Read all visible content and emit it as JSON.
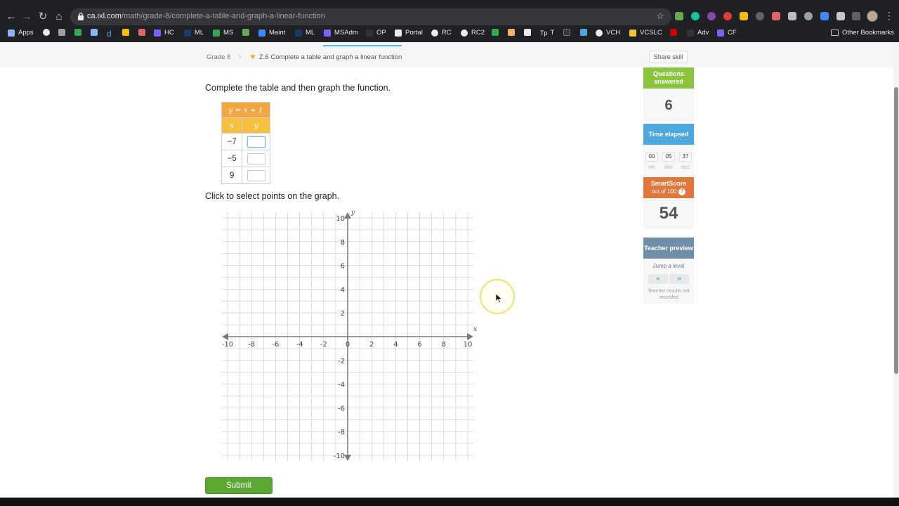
{
  "browser": {
    "url_host": "ca.ixl.com",
    "url_path": "/math/grade-8/complete-a-table-and-graph-a-linear-function",
    "bookmarks": [
      {
        "label": "Apps",
        "icon": "apps-grid-icon",
        "color": "#8ab4f8"
      },
      {
        "label": "",
        "icon": "star-bookmark-icon",
        "color": "#e8eaed"
      },
      {
        "label": "",
        "icon": "folder-icon",
        "color": "#9aa0a6"
      },
      {
        "label": "",
        "icon": "sheet-icon",
        "color": "#34a853"
      },
      {
        "label": "",
        "icon": "copy-icon",
        "color": "#8ab4f8"
      },
      {
        "label": "d",
        "icon": "d-icon",
        "color": "#4ea8de"
      },
      {
        "label": "",
        "icon": "drive-icon",
        "color": "#fbbc04"
      },
      {
        "label": "",
        "icon": "school-icon",
        "color": "#e06666"
      },
      {
        "label": "HC",
        "icon": "doc-icon",
        "color": "#7b61ff"
      },
      {
        "label": "ML",
        "icon": "ml-icon",
        "color": "#1a3a6b"
      },
      {
        "label": "MS",
        "icon": "plus-icon",
        "color": "#34a853"
      },
      {
        "label": "",
        "icon": "leaf-icon",
        "color": "#6aa84f"
      },
      {
        "label": "Maint",
        "icon": "doc-icon",
        "color": "#4285f4"
      },
      {
        "label": "ML",
        "icon": "ml-icon",
        "color": "#1a3a6b"
      },
      {
        "label": "MSAdm",
        "icon": "doc-icon",
        "color": "#7b61ff"
      },
      {
        "label": "OP",
        "icon": "op-icon",
        "color": "#333333"
      },
      {
        "label": "Portal",
        "icon": "portal-icon",
        "color": "#e8eaed"
      },
      {
        "label": "RC",
        "icon": "globe-icon",
        "color": "#e8eaed"
      },
      {
        "label": "RC2",
        "icon": "globe-icon",
        "color": "#e8eaed"
      },
      {
        "label": "",
        "icon": "r-icon",
        "color": "#34a853"
      },
      {
        "label": "",
        "icon": "box-icon",
        "color": "#f6b26b"
      },
      {
        "label": "",
        "icon": "hand-icon",
        "color": "#e69138"
      },
      {
        "label": "",
        "icon": "s-icon",
        "color": "#e8eaed"
      },
      {
        "label": "T",
        "icon": "tp-icon",
        "color": "#e8eaed"
      },
      {
        "label": "",
        "icon": "video-icon",
        "color": "#333333"
      },
      {
        "label": "",
        "icon": "link-icon",
        "color": "#4ea8de"
      },
      {
        "label": "VCH",
        "icon": "globe-icon",
        "color": "#e8eaed"
      },
      {
        "label": "VCSLC",
        "icon": "folder-yellow-icon",
        "color": "#f1c232"
      },
      {
        "label": "",
        "icon": "maple-icon",
        "color": "#cc0000"
      },
      {
        "label": "Adv",
        "icon": "adv-icon",
        "color": "#333333"
      },
      {
        "label": "CF",
        "icon": "doc-icon",
        "color": "#7b61ff"
      }
    ],
    "other_bookmarks": "Other Bookmarks"
  },
  "breadcrumb": {
    "grade": "Grade 8",
    "separator": "›",
    "skill": "Z.6 Complete a table and graph a linear function",
    "share_label": "Share skill"
  },
  "question": {
    "instruction": "Complete the table and then graph the function.",
    "equation": "y = x + 1",
    "col_x": "x",
    "col_y": "y",
    "rows": [
      {
        "x": "−7",
        "y": ""
      },
      {
        "x": "−5",
        "y": ""
      },
      {
        "x": "9",
        "y": ""
      }
    ],
    "graph_instruction": "Click to select points on the graph.",
    "submit_label": "Submit"
  },
  "graph": {
    "x_label": "x",
    "y_label": "y",
    "x_range": [
      -10,
      10
    ],
    "y_range": [
      -10,
      10
    ],
    "grid": true,
    "x_ticks": [
      "-10",
      "-8",
      "-6",
      "-4",
      "-2",
      "0",
      "2",
      "4",
      "6",
      "8",
      "10"
    ],
    "y_ticks": [
      "10",
      "8",
      "6",
      "4",
      "2",
      "-2",
      "-4",
      "-6",
      "-8",
      "-10"
    ],
    "colors": {
      "grid": "#d4d4d4",
      "axis": "#7a7a7a"
    }
  },
  "sidebar": {
    "questions_answered_label": "Questions answered",
    "questions_answered": "6",
    "time_elapsed_label": "Time elapsed",
    "time": {
      "hr": "00",
      "min": "05",
      "sec": "37"
    },
    "time_units": {
      "hr": "HR",
      "min": "MIN",
      "sec": "SEC"
    },
    "smartscore_label": "SmartScore",
    "smartscore_sub": "out of 100",
    "smartscore": "54",
    "teacher_preview_label": "Teacher preview",
    "jump_label": "Jump a level",
    "jump_prev": "«",
    "jump_next": "»",
    "teacher_note": "Teacher results not recorded",
    "colors": {
      "questions": "#8bc43f",
      "time": "#4ea8de",
      "smartscore": "#e2773d",
      "teacher": "#6f8ea8"
    }
  }
}
